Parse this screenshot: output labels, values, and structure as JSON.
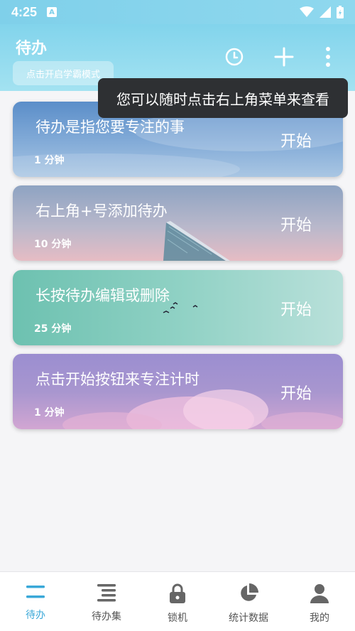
{
  "status_bar": {
    "time": "4:25",
    "notification_letter": "A"
  },
  "header": {
    "title": "待办",
    "study_mode_label": "点击开启学霸模式"
  },
  "tooltip": {
    "text": "您可以随时点击右上角菜单来查看"
  },
  "tasks": [
    {
      "title": "待办是指您要专注的事",
      "duration": "1 分钟",
      "action": "开始"
    },
    {
      "title": "右上角+号添加待办",
      "duration": "10 分钟",
      "action": "开始"
    },
    {
      "title": "长按待办编辑或删除",
      "duration": "25 分钟",
      "action": "开始"
    },
    {
      "title": "点击开始按钮来专注计时",
      "duration": "1 分钟",
      "action": "开始"
    }
  ],
  "bottom_nav": [
    {
      "label": "待办",
      "icon": "list-icon",
      "active": true
    },
    {
      "label": "待办集",
      "icon": "list-set-icon",
      "active": false
    },
    {
      "label": "锁机",
      "icon": "lock-icon",
      "active": false
    },
    {
      "label": "统计数据",
      "icon": "pie-chart-icon",
      "active": false
    },
    {
      "label": "我的",
      "icon": "person-icon",
      "active": false
    }
  ],
  "colors": {
    "accent": "#3aa8d8",
    "header": "#82d4ec",
    "tooltip_bg": "#2e3033"
  }
}
